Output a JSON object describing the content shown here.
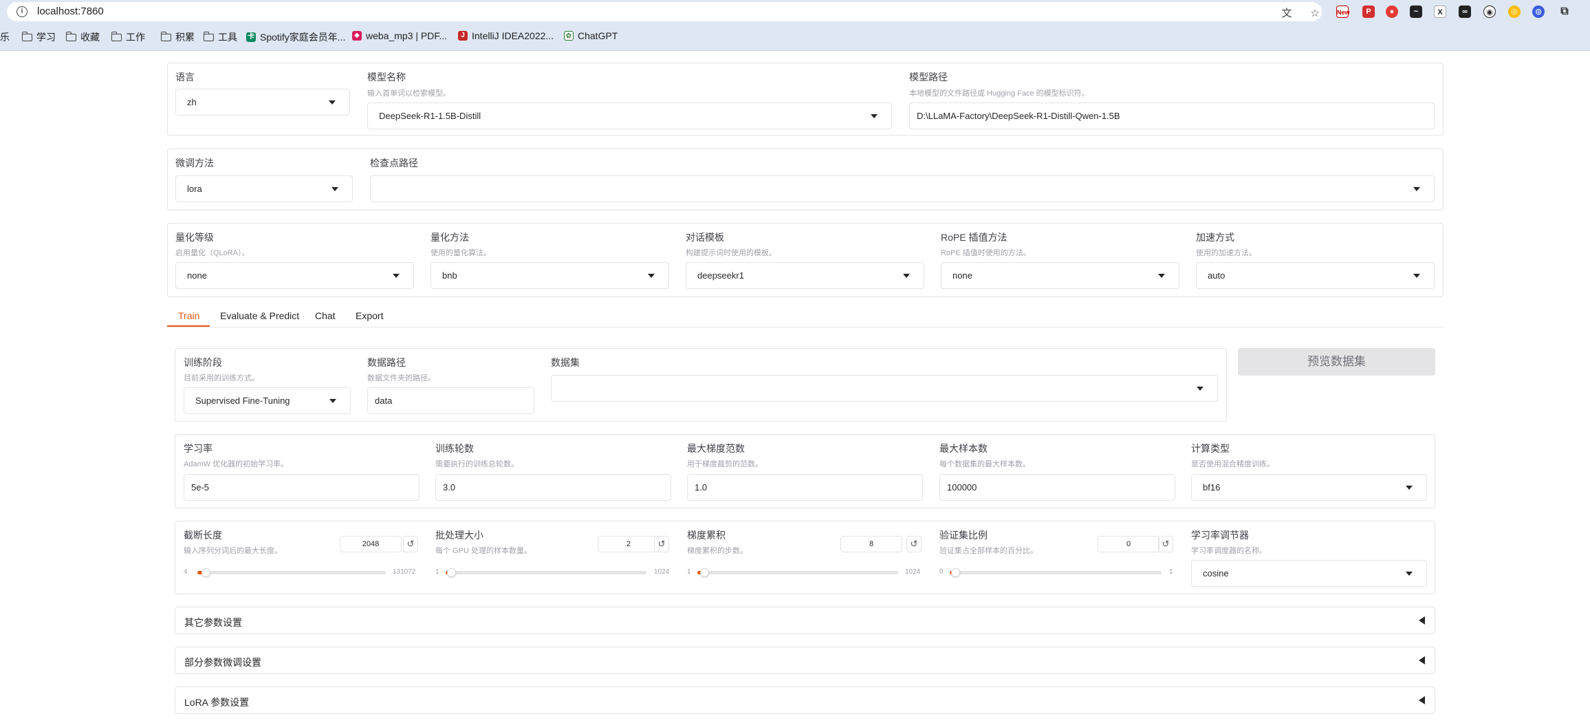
{
  "browser": {
    "url": "localhost:7860",
    "bookmarks": [
      {
        "label": "乐",
        "type": "text"
      },
      {
        "label": "学习",
        "type": "folder"
      },
      {
        "label": "收藏",
        "type": "folder"
      },
      {
        "label": "工作",
        "type": "folder"
      },
      {
        "label": "积累",
        "type": "folder"
      },
      {
        "label": "工具",
        "type": "folder"
      },
      {
        "label": "Spotify家庭会员年...",
        "type": "site"
      },
      {
        "label": "weba_mp3 | PDF...",
        "type": "site"
      },
      {
        "label": "IntelliJ IDEA2022...",
        "type": "site"
      },
      {
        "label": "ChatGPT",
        "type": "site"
      }
    ],
    "extension_badge": "New"
  },
  "top": {
    "lang_label": "语言",
    "lang_value": "zh",
    "model_name_label": "模型名称",
    "model_name_hint": "输入首单词以检索模型。",
    "model_name_value": "DeepSeek-R1-1.5B-Distill",
    "model_path_label": "模型路径",
    "model_path_hint": "本地模型的文件路径或 Hugging Face 的模型标识符。",
    "model_path_value": "D:\\LLaMA-Factory\\DeepSeek-R1-Distill-Qwen-1.5B"
  },
  "finetune": {
    "method_label": "微调方法",
    "method_value": "lora",
    "checkpoint_label": "检查点路径",
    "checkpoint_value": ""
  },
  "quant": {
    "level_label": "量化等级",
    "level_hint": "启用量化（QLoRA）。",
    "level_value": "none",
    "method_label": "量化方法",
    "method_hint": "使用的量化算法。",
    "method_value": "bnb",
    "template_label": "对话模板",
    "template_hint": "构建提示词时使用的模板。",
    "template_value": "deepseekr1",
    "rope_label": "RoPE 插值方法",
    "rope_hint": "RoPE 插值时使用的方法。",
    "rope_value": "none",
    "accel_label": "加速方式",
    "accel_hint": "使用的加速方法。",
    "accel_value": "auto"
  },
  "tabs": [
    "Train",
    "Evaluate & Predict",
    "Chat",
    "Export"
  ],
  "train": {
    "stage_label": "训练阶段",
    "stage_hint": "目前采用的训练方式。",
    "stage_value": "Supervised Fine-Tuning",
    "data_dir_label": "数据路径",
    "data_dir_hint": "数据文件夹的路径。",
    "data_dir_value": "data",
    "dataset_label": "数据集",
    "dataset_value": "",
    "preview_button": "预览数据集",
    "lr_label": "学习率",
    "lr_hint": "AdamW 优化器的初始学习率。",
    "lr_value": "5e-5",
    "epochs_label": "训练轮数",
    "epochs_hint": "需要执行的训练总轮数。",
    "epochs_value": "3.0",
    "grad_norm_label": "最大梯度范数",
    "grad_norm_hint": "用于梯度裁剪的范数。",
    "grad_norm_value": "1.0",
    "max_samples_label": "最大样本数",
    "max_samples_hint": "每个数据集的最大样本数。",
    "max_samples_value": "100000",
    "compute_type_label": "计算类型",
    "compute_type_hint": "是否使用混合精度训练。",
    "compute_type_value": "bf16",
    "sliders": [
      {
        "label": "截断长度",
        "hint": "输入序列分词后的最大长度。",
        "value": "2048",
        "min": "4",
        "max": "131072",
        "fraction": 0.0156
      },
      {
        "label": "批处理大小",
        "hint": "每个 GPU 处理的样本数量。",
        "value": "2",
        "min": "1",
        "max": "1024",
        "fraction": 0.001
      },
      {
        "label": "梯度累积",
        "hint": "梯度累积的步数。",
        "value": "8",
        "min": "1",
        "max": "1024",
        "fraction": 0.0068
      }
    ],
    "val_size": {
      "label": "验证集比例",
      "hint": "验证集占全部样本的百分比。",
      "value": "0",
      "min": "0",
      "max": "1",
      "fraction": 0
    },
    "scheduler_label": "学习率调节器",
    "scheduler_hint": "学习率调度器的名称。",
    "scheduler_value": "cosine",
    "accordions": [
      "其它参数设置",
      "部分参数微调设置",
      "LoRA 参数设置"
    ]
  },
  "colors": {
    "accent": "#ea580c",
    "border": "#e4e4e7",
    "chrome": "#dfe7f4"
  }
}
